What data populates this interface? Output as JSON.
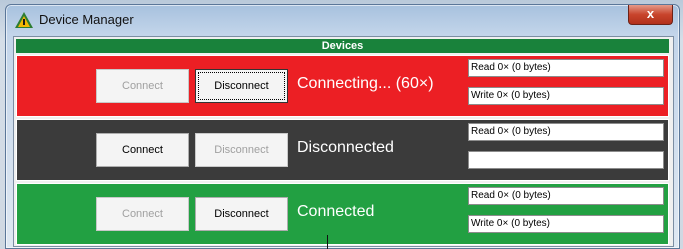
{
  "window": {
    "title": "Device Manager",
    "close_label": "x"
  },
  "group": {
    "header": "Devices"
  },
  "panels": [
    {
      "color": "#ec1f24",
      "connect_label": "Connect",
      "disconnect_label": "Disconnect",
      "connect_enabled": false,
      "disconnect_enabled": true,
      "status": "Connecting... (60×)",
      "read_text": "Read 0× (0 bytes)",
      "write_text": "Write 0× (0 bytes)"
    },
    {
      "color": "#3b3b3b",
      "connect_label": "Connect",
      "disconnect_label": "Disconnect",
      "connect_enabled": true,
      "disconnect_enabled": false,
      "status": "Disconnected",
      "read_text": "Read 0× (0 bytes)",
      "write_text": ""
    },
    {
      "color": "#22a042",
      "connect_label": "Connect",
      "disconnect_label": "Disconnect",
      "connect_enabled": false,
      "disconnect_enabled": true,
      "status": "Connected",
      "read_text": "Read 0× (0 bytes)",
      "write_text": "Write 0× (0 bytes)"
    }
  ],
  "colors": {
    "header_green": "#19823b"
  }
}
